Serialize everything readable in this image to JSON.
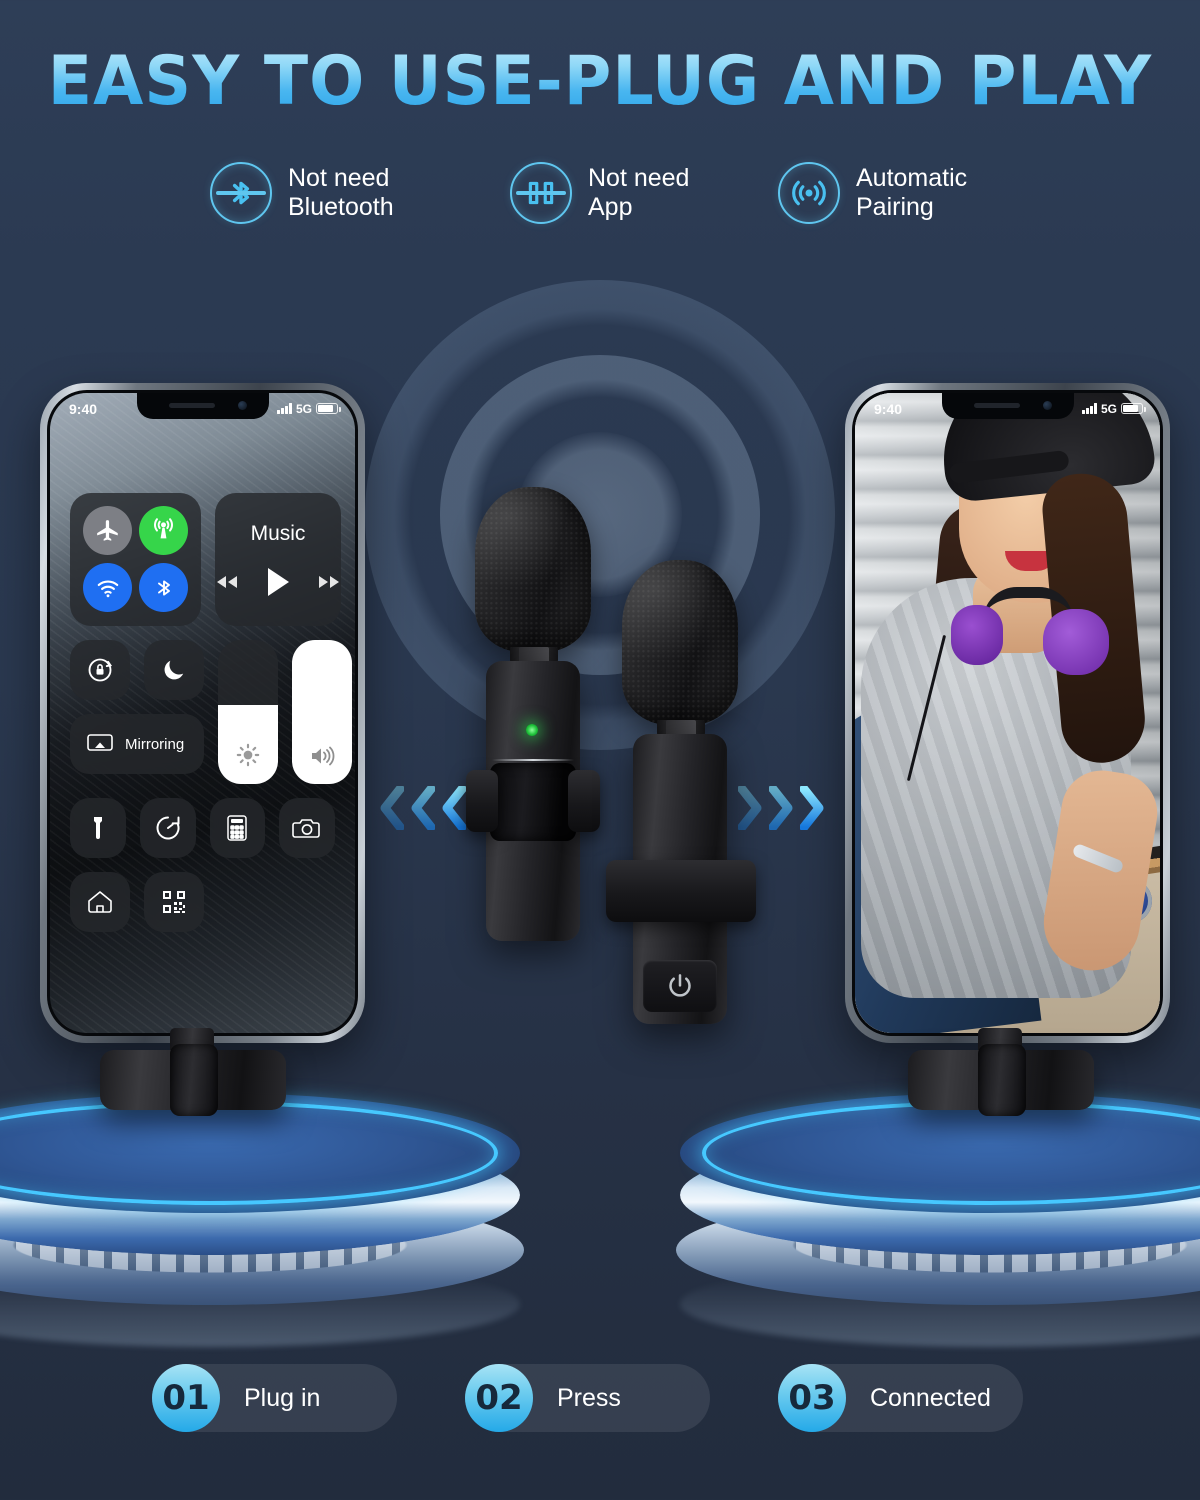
{
  "title": "EASY TO USE-PLUG AND PLAY",
  "colors": {
    "accent_cyan": "#5fc6ef",
    "accent_blue": "#24a9e8",
    "background_top": "#2e3e57",
    "background_bottom": "#222c3d",
    "led_green": "#2dd84f",
    "title_gradient_from": "#bfe9fb",
    "title_gradient_to": "#2aa3e8"
  },
  "features": [
    {
      "icon": "bluetooth-off-icon",
      "line1": "Not need",
      "line2": "Bluetooth"
    },
    {
      "icon": "app-off-icon",
      "line1": "Not need",
      "line2": "App"
    },
    {
      "icon": "auto-pairing-icon",
      "line1": "Automatic",
      "line2": "Pairing"
    }
  ],
  "phones": {
    "left": {
      "status": {
        "time": "9:40",
        "network": "5G",
        "signal_bars": 4,
        "battery_percent": 85
      },
      "control_center": {
        "connectivity": [
          {
            "name": "airplane-mode",
            "icon": "airplane-icon",
            "state": "off",
            "color": "#7d7f85"
          },
          {
            "name": "cellular-data",
            "icon": "cellular-icon",
            "state": "on",
            "color": "#36d54a"
          },
          {
            "name": "wifi",
            "icon": "wifi-icon",
            "state": "on",
            "color": "#1f6ff2"
          },
          {
            "name": "bluetooth",
            "icon": "bluetooth-icon",
            "state": "on",
            "color": "#1f6ff2"
          }
        ],
        "music": {
          "label": "Music",
          "prev": "previous-track-icon",
          "play": "play-icon",
          "next": "next-track-icon"
        },
        "rotation_lock": "rotation-lock-icon",
        "do_not_disturb": "moon-icon",
        "mirroring_label": "Mirroring",
        "brightness": {
          "icon": "brightness-icon",
          "value_percent": 55
        },
        "volume": {
          "icon": "volume-icon",
          "value_percent": 100
        },
        "shortcuts": [
          "flashlight-icon",
          "timer-icon",
          "calculator-icon",
          "camera-icon",
          "home-icon",
          "qr-scanner-icon"
        ]
      }
    },
    "right": {
      "status": {
        "time": "9:40",
        "network": "5G",
        "signal_bars": 4,
        "battery_percent": 85
      },
      "content_description": "woman-with-backwards-cap-photo"
    }
  },
  "microphones": [
    {
      "name": "receiver-microphone",
      "indicator": "led-green",
      "has_connector": true
    },
    {
      "name": "transmitter-microphone",
      "indicator": "power-button",
      "has_connector": false
    }
  ],
  "arrows": {
    "left": "chevrons-left-icon",
    "right": "chevrons-right-icon",
    "count": 3
  },
  "steps": [
    {
      "number": "01",
      "label": "Plug in"
    },
    {
      "number": "02",
      "label": "Press"
    },
    {
      "number": "03",
      "label": "Connected"
    }
  ]
}
